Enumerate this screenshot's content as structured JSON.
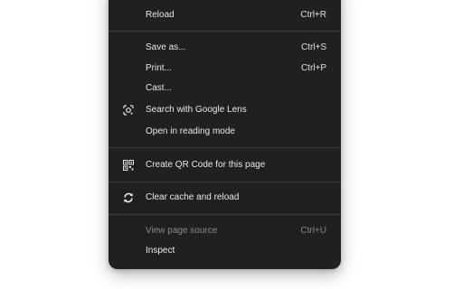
{
  "menu": {
    "items": [
      {
        "label": "Reload",
        "shortcut": "Ctrl+R"
      },
      {
        "label": "Save as...",
        "shortcut": "Ctrl+S"
      },
      {
        "label": "Print...",
        "shortcut": "Ctrl+P"
      },
      {
        "label": "Cast...",
        "shortcut": ""
      },
      {
        "label": "Search with Google Lens",
        "shortcut": "",
        "icon": "google-lens-icon"
      },
      {
        "label": "Open in reading mode",
        "shortcut": ""
      },
      {
        "label": "Create QR Code for this page",
        "shortcut": "",
        "icon": "qr-code-icon"
      },
      {
        "label": "Clear cache and reload",
        "shortcut": "",
        "icon": "clear-cache-icon"
      },
      {
        "label": "View page source",
        "shortcut": "Ctrl+U",
        "disabled": true
      },
      {
        "label": "Inspect",
        "shortcut": ""
      }
    ]
  },
  "colors": {
    "menu_bg": "#202020",
    "text": "#e8e8e8",
    "disabled_text": "#8a8a8a",
    "separator": "#3c3c3c"
  }
}
